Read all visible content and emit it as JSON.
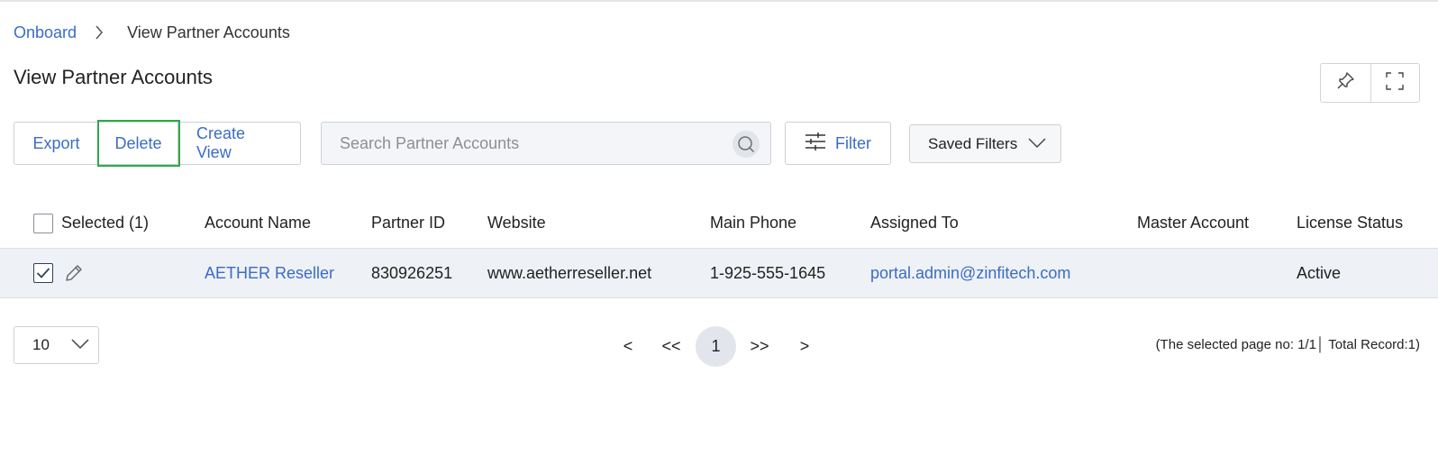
{
  "breadcrumb": {
    "root": "Onboard",
    "current": "View Partner Accounts"
  },
  "page": {
    "title": "View Partner Accounts"
  },
  "toolbar": {
    "export_label": "Export",
    "delete_label": "Delete",
    "create_view_label": "Create View",
    "search_placeholder": "Search Partner Accounts",
    "search_value": "",
    "filter_label": "Filter",
    "saved_filters_label": "Saved Filters"
  },
  "table": {
    "headers": {
      "selected": "Selected (1)",
      "account_name": "Account Name",
      "partner_id": "Partner ID",
      "website": "Website",
      "main_phone": "Main Phone",
      "assigned_to": "Assigned To",
      "master_account": "Master Account",
      "license_status": "License Status"
    },
    "rows": [
      {
        "selected": true,
        "account_name": "AETHER Reseller",
        "partner_id": "830926251",
        "website": "www.aetherreseller.net",
        "main_phone": "1-925-555-1645",
        "assigned_to": "portal.admin@zinfitech.com",
        "master_account": "",
        "license_status": "Active"
      }
    ]
  },
  "pagination": {
    "page_size": "10",
    "prev": "<",
    "first": "<<",
    "current": "1",
    "last": ">>",
    "next": ">",
    "info": "(The selected page no: 1/1│ Total Record:1)"
  },
  "colors": {
    "link": "#3b6cc4",
    "highlight_outline": "#2ea84d",
    "row_selected_bg": "#eef1f5"
  },
  "icons": [
    "chevron-right-icon",
    "pin-icon",
    "fullscreen-icon",
    "search-icon",
    "sliders-icon",
    "chevron-down-icon",
    "check-icon",
    "pencil-icon"
  ]
}
